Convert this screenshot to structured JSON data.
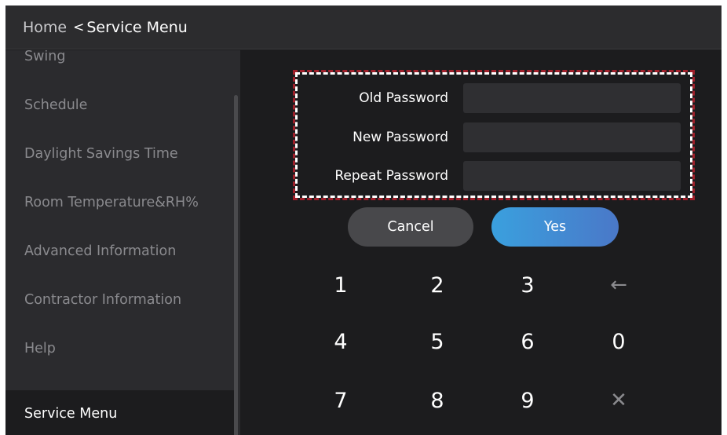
{
  "header": {
    "home_label": "Home",
    "back_glyph": "<",
    "title": "Service Menu"
  },
  "sidebar": {
    "items": [
      {
        "label": "Swing"
      },
      {
        "label": "Schedule"
      },
      {
        "label": "Daylight Savings Time"
      },
      {
        "label": "Room Temperature&RH%"
      },
      {
        "label": "Advanced Information"
      },
      {
        "label": "Contractor Information"
      },
      {
        "label": "Help"
      },
      {
        "label": "Service Menu",
        "active": true
      }
    ]
  },
  "form": {
    "old_password_label": "Old Password",
    "old_password_value": "",
    "new_password_label": "New Password",
    "new_password_value": "",
    "repeat_password_label": "Repeat Password",
    "repeat_password_value": ""
  },
  "buttons": {
    "cancel_label": "Cancel",
    "yes_label": "Yes"
  },
  "keypad": {
    "k1": "1",
    "k2": "2",
    "k3": "3",
    "backspace_glyph": "←",
    "k4": "4",
    "k5": "5",
    "k6": "6",
    "k0": "0",
    "k7": "7",
    "k8": "8",
    "k9": "9",
    "clear_glyph": "✕"
  },
  "colors": {
    "background": "#1c1c1e",
    "sidebar": "#2b2b2e",
    "accent_start": "#3aa0de",
    "accent_end": "#4a78c8",
    "highlight_border": "#a01f2a"
  }
}
